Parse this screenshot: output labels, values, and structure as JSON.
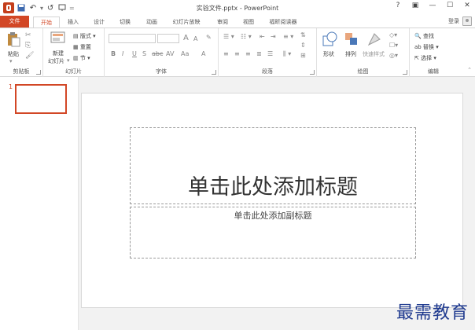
{
  "window": {
    "title": "实验文件.pptx - PowerPoint",
    "controls": [
      "?",
      "▣",
      "—",
      "☐",
      "✕"
    ]
  },
  "qat": {
    "save_icon": "💾",
    "undo_icon": "↶",
    "redo_icon": "↺",
    "present_icon": "🖵",
    "more_icon": "="
  },
  "tabs": {
    "file": "文件",
    "items": [
      "开始",
      "插入",
      "设计",
      "切换",
      "动画",
      "幻灯片放映",
      "审阅",
      "视图",
      "福昕阅读器"
    ],
    "active": "开始",
    "login": "登录"
  },
  "ribbon": {
    "clipboard": {
      "label": "剪贴板",
      "paste": "粘贴"
    },
    "slides": {
      "label": "幻灯片",
      "new_slide": "新建",
      "new_slide2": "幻灯片",
      "layout": "版式",
      "reset": "重置",
      "section": "节"
    },
    "font": {
      "label": "字体",
      "buttons": [
        "B",
        "I",
        "U",
        "S",
        "abc",
        "AV",
        "Aa",
        "A"
      ],
      "grow": "A",
      "shrink": "A"
    },
    "paragraph": {
      "label": "段落"
    },
    "drawing": {
      "label": "绘图",
      "shapes": "形状",
      "arrange": "排列",
      "quick_styles": "快速样式"
    },
    "editing": {
      "label": "编辑",
      "find": "查找",
      "replace": "替换",
      "select": "选择"
    }
  },
  "thumbnails": {
    "slide_number": "1"
  },
  "slide": {
    "title_placeholder": "单击此处添加标题",
    "subtitle_placeholder": "单击此处添加副标题"
  },
  "watermark": "最需教育",
  "colors": {
    "accent": "#d24726"
  }
}
